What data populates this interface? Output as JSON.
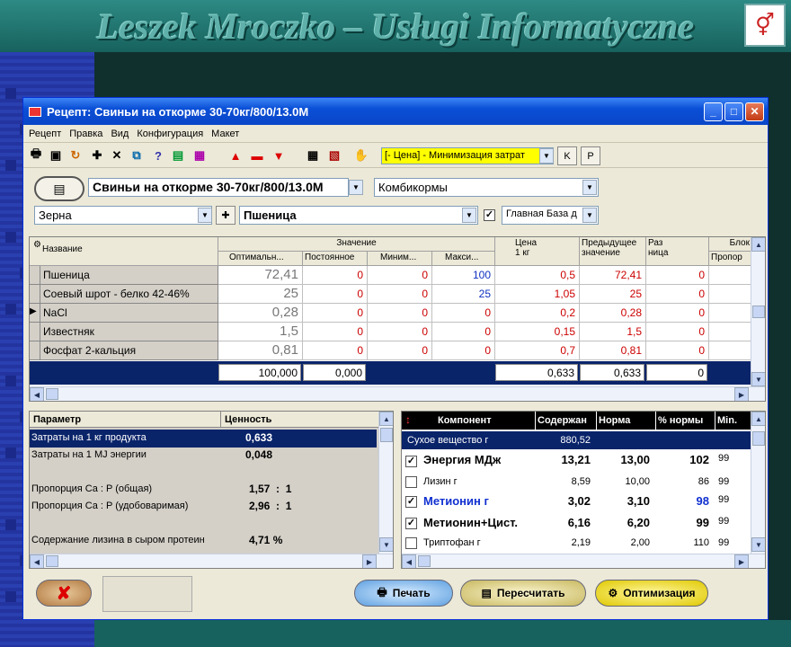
{
  "banner": {
    "title": "Leszek Mroczko – Usługi Informatyczne"
  },
  "window": {
    "title": "Рецепт: Свиньи на откорме 30-70кг/800/13.0М"
  },
  "menu": [
    "Рецепт",
    "Правка",
    "Вид",
    "Конфигурация",
    "Макет"
  ],
  "toolbar": {
    "mode": "[- Цена] - Минимизация затрат",
    "k_label": "K",
    "p_label": "P"
  },
  "recipe": {
    "name": "Свиньи на откорме 30-70кг/800/13.0М",
    "category": "Комбикормы"
  },
  "ingredient_row": {
    "group": "Зерна",
    "ingredient": "Пшеница",
    "base": "Главная База д"
  },
  "ingredients_grid": {
    "headers": {
      "name": "Название",
      "value_group": "Значение",
      "opt": "Оптимальн...",
      "const": "Постоянное",
      "min": "Миним...",
      "max": "Макси...",
      "price": "Цена\n1 кг",
      "prev": "Предыдущее\nзначение",
      "diff": "Раз\nница",
      "block": "Блок",
      "propor": "Пропор"
    },
    "rows": [
      {
        "name": "Пшеница",
        "opt": "72,41",
        "const": "0",
        "min": "0",
        "max": "100",
        "price": "0,5",
        "prev": "72,41",
        "diff": "0"
      },
      {
        "name": "Соевый шрот - белко 42-46%",
        "opt": "25",
        "const": "0",
        "min": "0",
        "max": "25",
        "price": "1,05",
        "prev": "25",
        "diff": "0"
      },
      {
        "name": "NaCl",
        "opt": "0,28",
        "const": "0",
        "min": "0",
        "max": "0",
        "price": "0,2",
        "prev": "0,28",
        "diff": "0"
      },
      {
        "name": "Известняк",
        "opt": "1,5",
        "const": "0",
        "min": "0",
        "max": "0",
        "price": "0,15",
        "prev": "1,5",
        "diff": "0"
      },
      {
        "name": "Фосфат 2-кальция",
        "opt": "0,81",
        "const": "0",
        "min": "0",
        "max": "0",
        "price": "0,7",
        "prev": "0,81",
        "diff": "0"
      }
    ],
    "totals": {
      "opt": "100,000",
      "const": "0,000",
      "price": "0,633",
      "prev": "0,633",
      "diff": "0"
    }
  },
  "params_panel": {
    "headers": {
      "param": "Параметр",
      "value": "Ценность"
    },
    "rows": [
      {
        "param": "Затраты на 1 кг продукта",
        "value": "0,633"
      },
      {
        "param": "Затраты на 1 MJ энергии",
        "value": "0,048"
      },
      {
        "param": "Пропорция Ca : P (общая)",
        "value": "1,57  :  1"
      },
      {
        "param": "Пропорция Ca : P (удобоваримая)",
        "value": "2,96  :  1"
      },
      {
        "param": "Содержание лизина в сыром протеин",
        "value": "4,71 %"
      }
    ]
  },
  "nutrients_panel": {
    "headers": {
      "component": "Компонент",
      "content": "Содержан",
      "norm": "Норма",
      "pct": "% нормы",
      "min": "Min."
    },
    "rows": [
      {
        "name": "Сухое вещество г",
        "content": "880,52",
        "norm": "",
        "pct": "",
        "min": ""
      },
      {
        "name": "Энергия МДж",
        "content": "13,21",
        "norm": "13,00",
        "pct": "102",
        "min": "99"
      },
      {
        "name": "Лизин г",
        "content": "8,59",
        "norm": "10,00",
        "pct": "86",
        "min": "99"
      },
      {
        "name": "Метионин г",
        "content": "3,02",
        "norm": "3,10",
        "pct": "98",
        "min": "99"
      },
      {
        "name": "Метионин+Цист.",
        "content": "6,16",
        "norm": "6,20",
        "pct": "99",
        "min": "99"
      },
      {
        "name": "Триптофан г",
        "content": "2,19",
        "norm": "2,00",
        "pct": "110",
        "min": "99"
      }
    ]
  },
  "buttons": {
    "print": "Печать",
    "recalc": "Пересчитать",
    "optimize": "Оптимизация"
  },
  "colors": {
    "title_blue": "#0a4fd6",
    "selection": "#0a246a",
    "mode_yellow": "#ffff00",
    "value_red": "#cc0000"
  }
}
